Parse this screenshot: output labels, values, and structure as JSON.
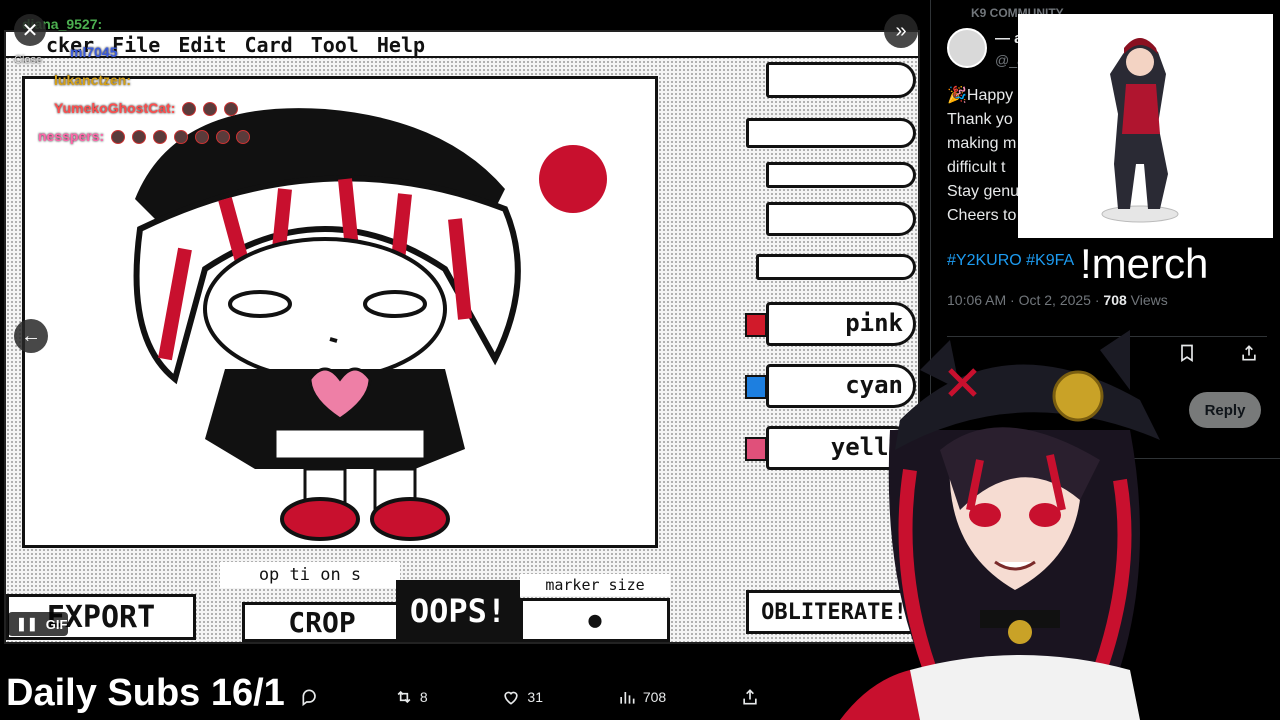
{
  "viewer": {
    "close_label": "Close",
    "next_icon": "double-chevron-right-icon",
    "prev_icon": "arrow-left-icon",
    "gif_label": "GIF"
  },
  "paint_app": {
    "menu": [
      "cker",
      "File",
      "Edit",
      "Card",
      "Tool",
      "Help"
    ],
    "markers": [
      "pink",
      "cyan",
      "yelle"
    ],
    "marker_colors": [
      "#d11a2a",
      "#1d7fe0",
      "#e0507a"
    ],
    "buttons": {
      "export": "EXPORT",
      "options": "op ti on s",
      "crop": "CROP",
      "oops": "OOPS!",
      "marker_size": "marker size",
      "obliterate": "OBLITERATE!"
    }
  },
  "chat": [
    {
      "user": "diana_9527:",
      "color": "#4caf50"
    },
    {
      "user": "ml7045",
      "color": "#3b5bdb"
    },
    {
      "user": "lukanctzen:",
      "color": "#d4a017"
    },
    {
      "user": "YumekoGhostCat:",
      "color": "#ff4d4d"
    },
    {
      "user": "nesspers:",
      "color": "#ff66aa"
    }
  ],
  "tweet_actions": {
    "retweets": "8",
    "likes": "31",
    "views": "708"
  },
  "overlay": {
    "daily_subs": "Daily Subs 16/1",
    "merch": "!merch"
  },
  "tweet": {
    "community": "K9 COMMUNITY",
    "display_name": "— a",
    "handle": "@_a",
    "lines": [
      "🎉Happy",
      "Thank yo",
      "making m",
      "difficult t",
      "Stay genu",
      "Cheers to"
    ],
    "hashtags": "#Y2KURO #K9FA",
    "time": "10:06 AM · Oct 2, 2025 · ",
    "views_count": "708",
    "views_label": " Views",
    "reply_label": "Reply"
  },
  "colors": {
    "accent_blue": "#1d9bf0",
    "muted": "#71767b",
    "kuro_red": "#c8102e"
  }
}
